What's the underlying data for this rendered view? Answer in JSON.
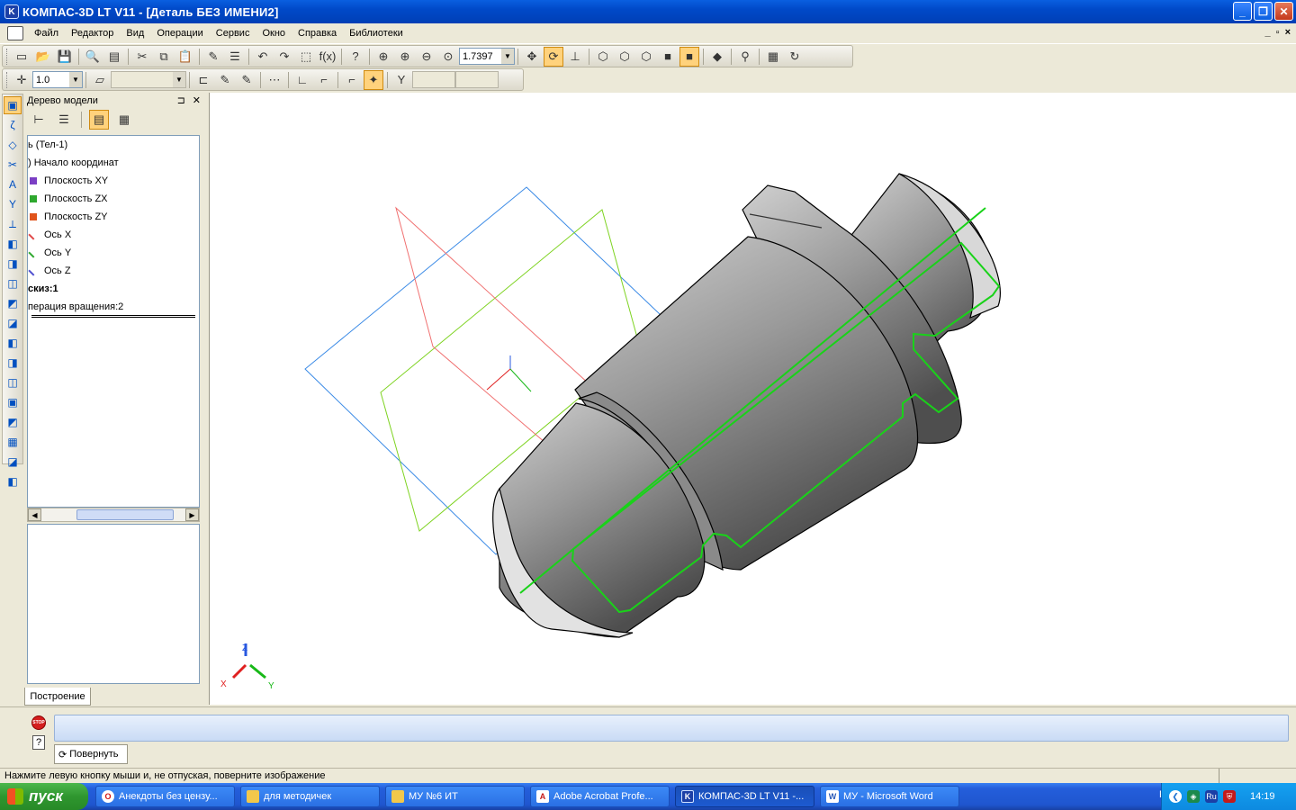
{
  "window": {
    "title": "КОМПАС-3D LT V11 - [Деталь БЕЗ ИМЕНИ2]",
    "app_icon": "K"
  },
  "menu": {
    "items": [
      "Файл",
      "Редактор",
      "Вид",
      "Операции",
      "Сервис",
      "Окно",
      "Справка",
      "Библиотеки"
    ],
    "mdi": [
      "_",
      "▫",
      "×"
    ]
  },
  "toolbar": {
    "zoom_value": "1.7397",
    "line_step": "1.0"
  },
  "model_tree": {
    "title": "Дерево модели",
    "items": [
      {
        "label": "ь (Тел-1)",
        "marker": ""
      },
      {
        "label": ") Начало координат",
        "marker": ""
      },
      {
        "label": "Плоскость XY",
        "marker": "#7b3fc4"
      },
      {
        "label": "Плоскость ZX",
        "marker": "#2ea82e"
      },
      {
        "label": "Плоскость ZY",
        "marker": "#e0541c"
      },
      {
        "label": "Ось X",
        "marker": "#e04848"
      },
      {
        "label": "Ось Y",
        "marker": "#2ea82e"
      },
      {
        "label": "Ось Z",
        "marker": "#5050d0"
      },
      {
        "label": "скиз:1",
        "marker": "",
        "bold": true
      },
      {
        "label": "перация вращения:2",
        "marker": ""
      }
    ],
    "tab_label": "Построение"
  },
  "viewport": {
    "axes": {
      "x": "X",
      "y": "Y",
      "z": "Z"
    },
    "colors": {
      "sketch": "#19d219",
      "plane_xy": "#3a8ae6",
      "plane_zx": "#7ed321",
      "plane_zy": "#f07070",
      "axis_x": "#e02020",
      "axis_y": "#18b818",
      "axis_z": "#2858e0"
    }
  },
  "command": {
    "rotate_label": "Повернуть"
  },
  "status": {
    "text": "Нажмите левую кнопку мыши и, не отпуская, поверните изображение"
  },
  "taskbar": {
    "start_label": "пуск",
    "tasks": [
      {
        "label": "Анекдоты без цензу...",
        "icon": "opera-icon",
        "color": "#d21414"
      },
      {
        "label": "для методичек",
        "icon": "folder-icon",
        "color": "#f2c84b"
      },
      {
        "label": "МУ №6 ИТ",
        "icon": "folder-icon",
        "color": "#f2c84b"
      },
      {
        "label": "Adobe Acrobat Profe...",
        "icon": "acrobat-icon",
        "color": "#c41a1a"
      },
      {
        "label": "КОМПАС-3D LT V11 -...",
        "icon": "kompas-icon",
        "color": "#1b3fa6"
      },
      {
        "label": "МУ - Microsoft Word",
        "icon": "word-icon",
        "color": "#2b5bb8"
      }
    ],
    "lang": "RU",
    "tray_lang": "Ru",
    "clock": "14:19"
  }
}
